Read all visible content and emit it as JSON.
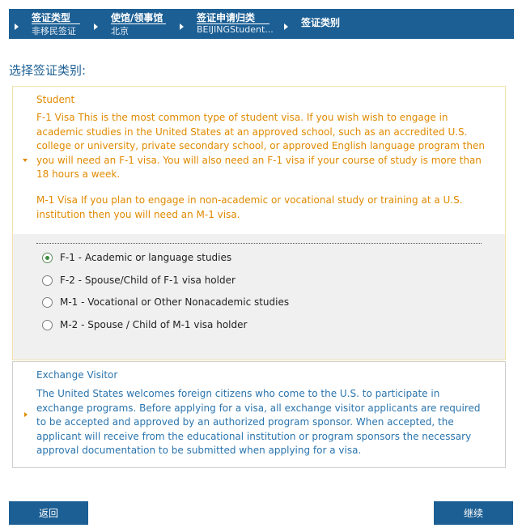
{
  "breadcrumb": {
    "items": [
      {
        "title": "签证类型",
        "sub": "非移民签证"
      },
      {
        "title": "使馆/领事馆",
        "sub": "北京"
      },
      {
        "title": "签证申请归类",
        "sub": "BEIJINGStudent..."
      },
      {
        "title": "签证类别",
        "sub": ""
      }
    ]
  },
  "page": {
    "heading": "选择签证类别:"
  },
  "student": {
    "title": "Student",
    "para1": "F-1 Visa This is the most common type of student visa. If you wish wish to engage in academic studies in the United States at an approved school, such as an accredited U.S. college or university, private secondary school, or approved English language program then you will need an F-1 visa. You will also need an F-1 visa if your course of study is more than 18 hours a week.",
    "para2": "M-1 Visa If you plan to engage in non-academic or vocational study or training at a U.S. institution then you will need an M-1 visa.",
    "options": [
      {
        "label": "F-1 - Academic or language studies",
        "selected": true
      },
      {
        "label": "F-2 - Spouse/Child of F-1 visa holder",
        "selected": false
      },
      {
        "label": "M-1 - Vocational or Other Nonacademic studies",
        "selected": false
      },
      {
        "label": "M-2 - Spouse / Child of M-1 visa holder",
        "selected": false
      }
    ]
  },
  "exchange": {
    "title": "Exchange Visitor",
    "para": "The United States welcomes foreign citizens who come to the U.S. to participate in exchange programs. Before applying for a visa, all exchange visitor applicants are required to be accepted and approved by an authorized program sponsor. When accepted, the applicant will receive from the educational institution or program sponsors the necessary approval documentation to be submitted when applying for a visa."
  },
  "buttons": {
    "back": "返回",
    "next": "继续"
  },
  "colors": {
    "primary": "#1c5f94",
    "orange_text": "#e08a00",
    "blue_text": "#2a74ad"
  },
  "icons": {
    "crumb_arrow": "triangle-right",
    "expanded": "triangle-down",
    "collapsed": "triangle-right"
  }
}
